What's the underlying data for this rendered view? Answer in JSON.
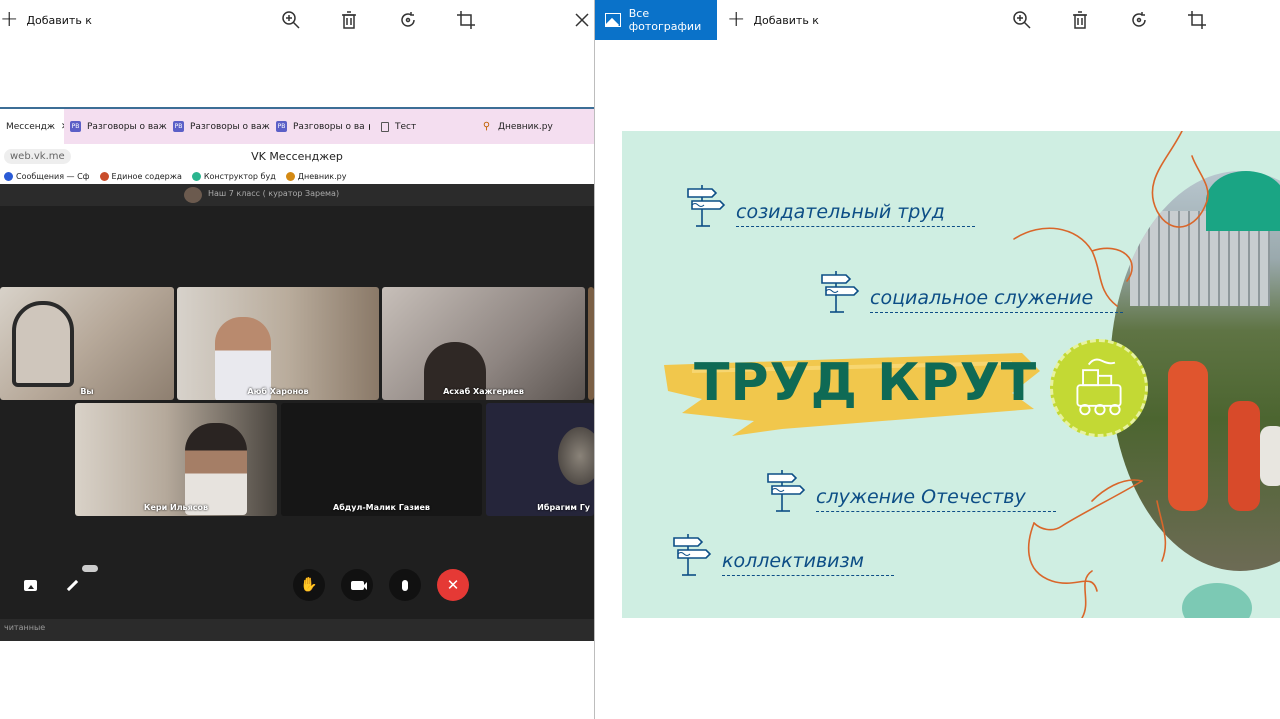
{
  "left_window": {
    "toolbar": {
      "add_label": "Добавить к"
    },
    "browser": {
      "tabs": [
        {
          "label": "Мессендж",
          "fav": "vk"
        },
        {
          "label": "Разговоры о важн",
          "fav": "РВ"
        },
        {
          "label": "Разговоры о важн",
          "fav": "РВ"
        },
        {
          "label": "Разговоры о ва",
          "fav": "РВ"
        },
        {
          "label": "Тест",
          "fav": "doc"
        },
        {
          "label": "Дневник.ру",
          "fav": "dn"
        }
      ],
      "url": "web.vk.me",
      "page_title": "VK Мессенджер",
      "bookmarks": [
        {
          "label": "Сообщения — Сф",
          "color": "#2a5bd6"
        },
        {
          "label": "Единое содержа",
          "color": "#c94d2b"
        },
        {
          "label": "Конструктор буд",
          "color": "#2bb58f"
        },
        {
          "label": "Дневник.ру",
          "color": "#d48a14"
        }
      ],
      "chat_name": "Наш 7 класс ( куратор Зарема)",
      "bottom_text": "читанные"
    },
    "participants": [
      {
        "name": "Вы"
      },
      {
        "name": "Аюб Харонов"
      },
      {
        "name": "Асхаб Хажгериев"
      },
      {
        "name": "Кери Ильясов"
      },
      {
        "name": "Абдул-Малик Газиев"
      },
      {
        "name": "Ибрагим Гу"
      }
    ],
    "controls": {
      "share_icon": "screen-share-icon",
      "pen_icon": "pen-icon",
      "hand_icon": "raise-hand-icon",
      "camera_icon": "camera-icon",
      "mic_icon": "microphone-icon",
      "end_icon": "end-call-icon",
      "end_color": "#e53935"
    }
  },
  "right_window": {
    "toolbar": {
      "all_photos_label": "Все фотографии",
      "add_label": "Добавить к",
      "accent": "#0a72c9"
    },
    "slide": {
      "items": [
        "созидательный труд",
        "социальное служение",
        "служение Отечеству",
        "коллективизм"
      ],
      "title": "ТРУД КРУТ",
      "colors": {
        "background": "#cfeee2",
        "text": "#0d4e86",
        "title": "#0f6a55",
        "brush": "#f2c443",
        "badge": "#c3d934",
        "line_art": "#d9662a"
      }
    }
  }
}
